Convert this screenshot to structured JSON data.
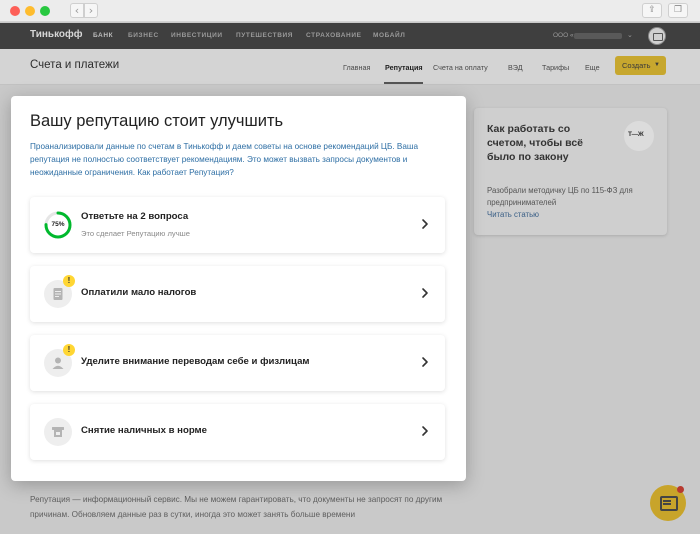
{
  "topnav": {
    "brand": "Тинькофф",
    "items": [
      "БАНК",
      "БИЗНЕС",
      "ИНВЕСТИЦИИ",
      "ПУТЕШЕСТВИЯ",
      "СТРАХОВАНИЕ",
      "МОБАЙЛ"
    ],
    "account_prefix": "ООО «"
  },
  "subheader": {
    "title": "Счета и платежи",
    "tabs": [
      "Главная",
      "Репутация",
      "Счета на оплату",
      "ВЭД",
      "Тарифы",
      "Еще"
    ],
    "create_label": "Создать"
  },
  "side_card": {
    "title": "Как работать со счетом, чтобы всё было по закону",
    "text": "Разобрали методичку ЦБ по 115-ФЗ для предпринимателей",
    "link": "Читать статью",
    "badge": "Т—Ж"
  },
  "footer_note": "Репутация — информационный сервис. Мы не можем гарантировать, что документы не запросят по другим причинам. Обновляем данные раз в сутки, иногда это может занять больше времени",
  "modal": {
    "title": "Вашу репутацию стоит улучшить",
    "description": "Проанализировали данные по счетам в Тинькофф и даем советы на основе рекомендаций ЦБ. Ваша репутация не полностью соответствует рекомендациям. Это может вызвать запросы документов и неожиданные ограничения. Как работает Репутация?",
    "items": [
      {
        "title": "Ответьте на 2 вопроса",
        "subtitle": "Это сделает Репутацию лучше",
        "progress_label": "75%",
        "progress": 0.75
      },
      {
        "title": "Оплатили мало налогов",
        "warning": "!"
      },
      {
        "title": "Уделите внимание переводам себе и физлицам",
        "warning": "!"
      },
      {
        "title": "Снятие наличных в норме"
      }
    ]
  },
  "colors": {
    "accent_yellow": "#ffdd2d",
    "link_blue": "#2d6ea4",
    "progress_green": "#00b92d"
  }
}
